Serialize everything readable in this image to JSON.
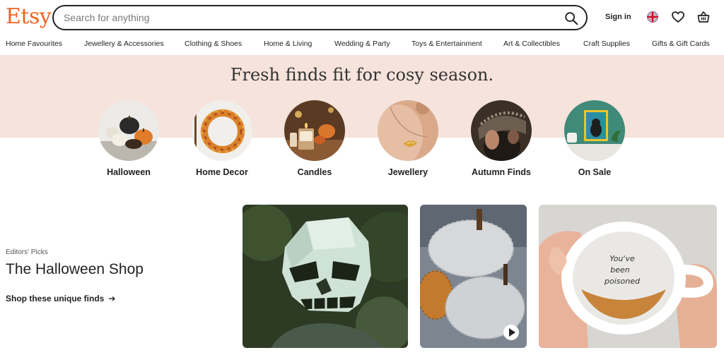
{
  "header": {
    "logo": "Etsy",
    "search_placeholder": "Search for anything",
    "signin_label": "Sign in",
    "icons": [
      "search-icon",
      "uk-flag-icon",
      "heart-icon",
      "basket-icon"
    ]
  },
  "nav": {
    "items": [
      "Home Favourites",
      "Jewellery & Accessories",
      "Clothing & Shoes",
      "Home & Living",
      "Wedding & Party",
      "Toys & Entertainment",
      "Art & Collectibles",
      "Craft Supplies",
      "Gifts & Gift Cards"
    ]
  },
  "banner": {
    "title": "Fresh finds fit for cosy season."
  },
  "categories": [
    {
      "label": "Halloween"
    },
    {
      "label": "Home Decor"
    },
    {
      "label": "Candles"
    },
    {
      "label": "Jewellery"
    },
    {
      "label": "Autumn Finds"
    },
    {
      "label": "On Sale"
    }
  ],
  "picks": {
    "eyebrow": "Editors' Picks",
    "title": "The Halloween Shop",
    "link": "Shop these unique finds",
    "arrow": "➔",
    "mug_text": [
      "You've",
      "been",
      "poisoned"
    ]
  },
  "colors": {
    "brand": "#F1641E",
    "banner_bg": "#F5E3DC"
  }
}
